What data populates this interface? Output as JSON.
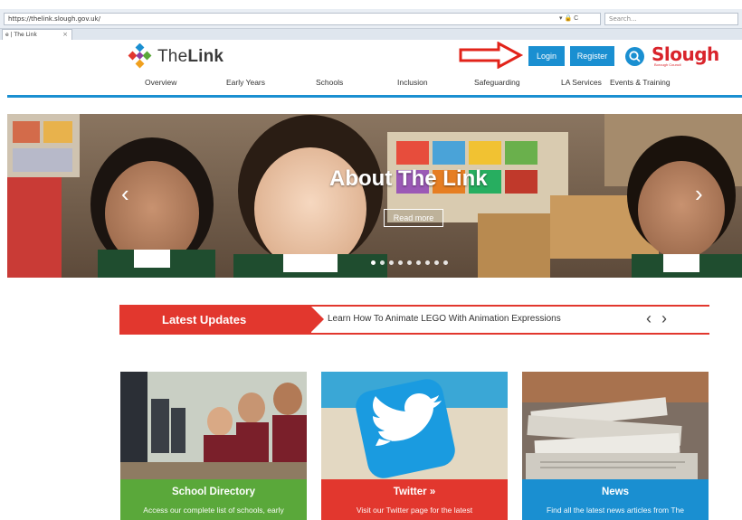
{
  "browser": {
    "url": "https://thelink.slough.gov.uk/",
    "controls": "▾ 🔒 C",
    "search_placeholder": "Search...",
    "tab_title": "e | The Link",
    "tab_close": "×"
  },
  "header": {
    "logo_text_light": "The",
    "logo_text_bold": "Link",
    "login_label": "Login",
    "register_label": "Register",
    "council_name": "Slough",
    "council_sub": "Borough Council"
  },
  "nav": {
    "items": [
      {
        "label": "Overview"
      },
      {
        "label": "Early Years"
      },
      {
        "label": "Schools"
      },
      {
        "label": "Inclusion"
      },
      {
        "label": "Safeguarding"
      },
      {
        "label": "LA Services"
      },
      {
        "label": "Events & Training"
      }
    ]
  },
  "hero": {
    "title": "About The Link",
    "button_label": "Read more",
    "prev_icon": "‹",
    "next_icon": "›",
    "slide_count": 9,
    "active_slide": 0
  },
  "updates": {
    "label": "Latest Updates",
    "headline": "Learn How To Animate LEGO With Animation Expressions",
    "prev_icon": "‹",
    "next_icon": "›"
  },
  "cards": [
    {
      "title": "School Directory",
      "desc": "Access our complete list of schools, early",
      "color": "#5aa83a"
    },
    {
      "title": "Twitter »",
      "desc": "Visit our Twitter page for the latest",
      "color": "#e2372e"
    },
    {
      "title": "News",
      "desc": "Find all the latest news articles from The",
      "color": "#1a8fd1"
    }
  ],
  "colors": {
    "accent_blue": "#1a8fd1",
    "accent_red": "#e2372e",
    "accent_green": "#5aa83a",
    "slough_red": "#d9242b"
  }
}
